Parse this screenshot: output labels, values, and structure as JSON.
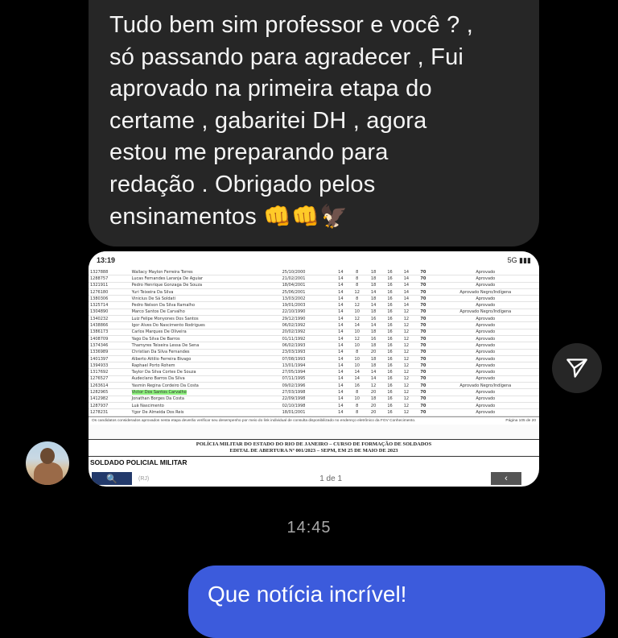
{
  "incoming_message": {
    "text": "Tudo bem sim professor e você ?   ,\nsó passando para agradecer , Fui\naprovado na primeira etapa do\ncertame ,  gabaritei DH , agora\nestou me preparando para\nredação .  Obrigado pelos\nensinamentos",
    "emojis": "👊👊🦅"
  },
  "screenshot": {
    "status_time": "13:19",
    "status_right": "5G ▮▮▮",
    "rows": [
      {
        "id": "1327888",
        "name": "Wallacy Maylon Ferreira Torres",
        "date": "25/10/2000",
        "a": "14",
        "b": "8",
        "c": "18",
        "d": "16",
        "e": "14",
        "total": "70",
        "result": "Aprovado"
      },
      {
        "id": "1288757",
        "name": "Lucas Fernandes Laranja De Aguiar",
        "date": "21/02/2001",
        "a": "14",
        "b": "8",
        "c": "18",
        "d": "16",
        "e": "14",
        "total": "70",
        "result": "Aprovado"
      },
      {
        "id": "1321911",
        "name": "Pedro Henrique Gonzaga De Souza",
        "date": "18/04/2001",
        "a": "14",
        "b": "8",
        "c": "18",
        "d": "16",
        "e": "14",
        "total": "70",
        "result": "Aprovado"
      },
      {
        "id": "1276180",
        "name": "Yuri Teixeira Da Silva",
        "date": "25/06/2001",
        "a": "14",
        "b": "12",
        "c": "14",
        "d": "16",
        "e": "14",
        "total": "70",
        "result": "Aprovado Negro/Indígena"
      },
      {
        "id": "1380306",
        "name": "Vinicius De Sá Soldati",
        "date": "13/03/2002",
        "a": "14",
        "b": "8",
        "c": "18",
        "d": "16",
        "e": "14",
        "total": "70",
        "result": "Aprovado"
      },
      {
        "id": "1325714",
        "name": "Pedro Nelson Da Silva Ramalho",
        "date": "19/01/2003",
        "a": "14",
        "b": "12",
        "c": "14",
        "d": "16",
        "e": "14",
        "total": "70",
        "result": "Aprovado"
      },
      {
        "id": "1304890",
        "name": "Marco Santos De Carvalho",
        "date": "22/10/1990",
        "a": "14",
        "b": "10",
        "c": "18",
        "d": "16",
        "e": "12",
        "total": "70",
        "result": "Aprovado Negro/Indígena"
      },
      {
        "id": "1340232",
        "name": "Luiz Felipe Monyones Dos Santos",
        "date": "29/12/1990",
        "a": "14",
        "b": "12",
        "c": "16",
        "d": "16",
        "e": "12",
        "total": "70",
        "result": "Aprovado"
      },
      {
        "id": "1438866",
        "name": "Igor Alves Do Nascimento Rodrigues",
        "date": "06/02/1992",
        "a": "14",
        "b": "14",
        "c": "14",
        "d": "16",
        "e": "12",
        "total": "70",
        "result": "Aprovado"
      },
      {
        "id": "1386173",
        "name": "Carlos Marques De Oliveira",
        "date": "20/02/1992",
        "a": "14",
        "b": "10",
        "c": "18",
        "d": "16",
        "e": "12",
        "total": "70",
        "result": "Aprovado"
      },
      {
        "id": "1408709",
        "name": "Yago Da Silva De Barros",
        "date": "01/11/1992",
        "a": "14",
        "b": "12",
        "c": "16",
        "d": "16",
        "e": "12",
        "total": "70",
        "result": "Aprovado"
      },
      {
        "id": "1374346",
        "name": "Thamyres Teixeira Lessa De Sena",
        "date": "06/02/1993",
        "a": "14",
        "b": "10",
        "c": "18",
        "d": "16",
        "e": "12",
        "total": "70",
        "result": "Aprovado"
      },
      {
        "id": "1336989",
        "name": "Christian Da Silva Fernandes",
        "date": "23/03/1993",
        "a": "14",
        "b": "8",
        "c": "20",
        "d": "16",
        "e": "12",
        "total": "70",
        "result": "Aprovado"
      },
      {
        "id": "1401397",
        "name": "Alberto Attilio Ferreira Bivago",
        "date": "07/08/1993",
        "a": "14",
        "b": "10",
        "c": "18",
        "d": "16",
        "e": "12",
        "total": "70",
        "result": "Aprovado"
      },
      {
        "id": "1394933",
        "name": "Raphael Porto Rohem",
        "date": "13/01/1994",
        "a": "14",
        "b": "10",
        "c": "18",
        "d": "16",
        "e": "12",
        "total": "70",
        "result": "Aprovado"
      },
      {
        "id": "1317692",
        "name": "Taylor Da Silva Cortes De Souza",
        "date": "27/05/1994",
        "a": "14",
        "b": "14",
        "c": "14",
        "d": "16",
        "e": "12",
        "total": "70",
        "result": "Aprovado"
      },
      {
        "id": "1276527",
        "name": "Audeclano Barros Da Silva",
        "date": "07/11/1995",
        "a": "14",
        "b": "14",
        "c": "14",
        "d": "16",
        "e": "12",
        "total": "70",
        "result": "Aprovado"
      },
      {
        "id": "1263614",
        "name": "Yasmin Regina Cordeiro Da Costa",
        "date": "09/02/1996",
        "a": "14",
        "b": "16",
        "c": "12",
        "d": "16",
        "e": "12",
        "total": "70",
        "result": "Aprovado Negro/Indígena"
      },
      {
        "id": "1282965",
        "name": "Victor Dos Santos Carvalho",
        "date": "27/03/1998",
        "a": "14",
        "b": "8",
        "c": "20",
        "d": "16",
        "e": "12",
        "total": "70",
        "result": "Aprovado",
        "highlight": true
      },
      {
        "id": "1412982",
        "name": "Jonathan Borges Da Costa",
        "date": "22/09/1998",
        "a": "14",
        "b": "10",
        "c": "18",
        "d": "16",
        "e": "12",
        "total": "70",
        "result": "Aprovado"
      },
      {
        "id": "1287937",
        "name": "Luã Nascimento",
        "date": "02/10/1998",
        "a": "14",
        "b": "8",
        "c": "20",
        "d": "16",
        "e": "12",
        "total": "70",
        "result": "Aprovado"
      },
      {
        "id": "1278231",
        "name": "Ygor De Almeida Dos Reis",
        "date": "18/01/2001",
        "a": "14",
        "b": "8",
        "c": "20",
        "d": "16",
        "e": "12",
        "total": "70",
        "result": "Aprovado"
      }
    ],
    "footnote": "Os candidatos considerados aprovados nesta etapa deverão verificar seu desempenho por meio do link individual de consulta disponibilizado no endereço eletrônico da FGV Conhecimento.",
    "page_label": "Página 105 de 20",
    "doc_header_1": "POLÍCIA MILITAR DO ESTADO DO RIO DE JANEIRO – CURSO DE FORMAÇÃO DE SOLDADOS",
    "doc_header_2": "EDITAL DE ABERTURA Nº 001/2023 – SEPM, EM 25 DE MAIO DE 2023",
    "section_title": "SOLDADO POLICIAL MILITAR",
    "location": "(RJ)",
    "pager": "1 de 1"
  },
  "timestamp": "14:45",
  "outgoing_message": {
    "text": "Que notícia incrível!"
  },
  "colors": {
    "background": "#000000",
    "incoming_bubble": "#262626",
    "outgoing_bubble": "#3c5bdc",
    "highlight": "#8cf07c"
  }
}
